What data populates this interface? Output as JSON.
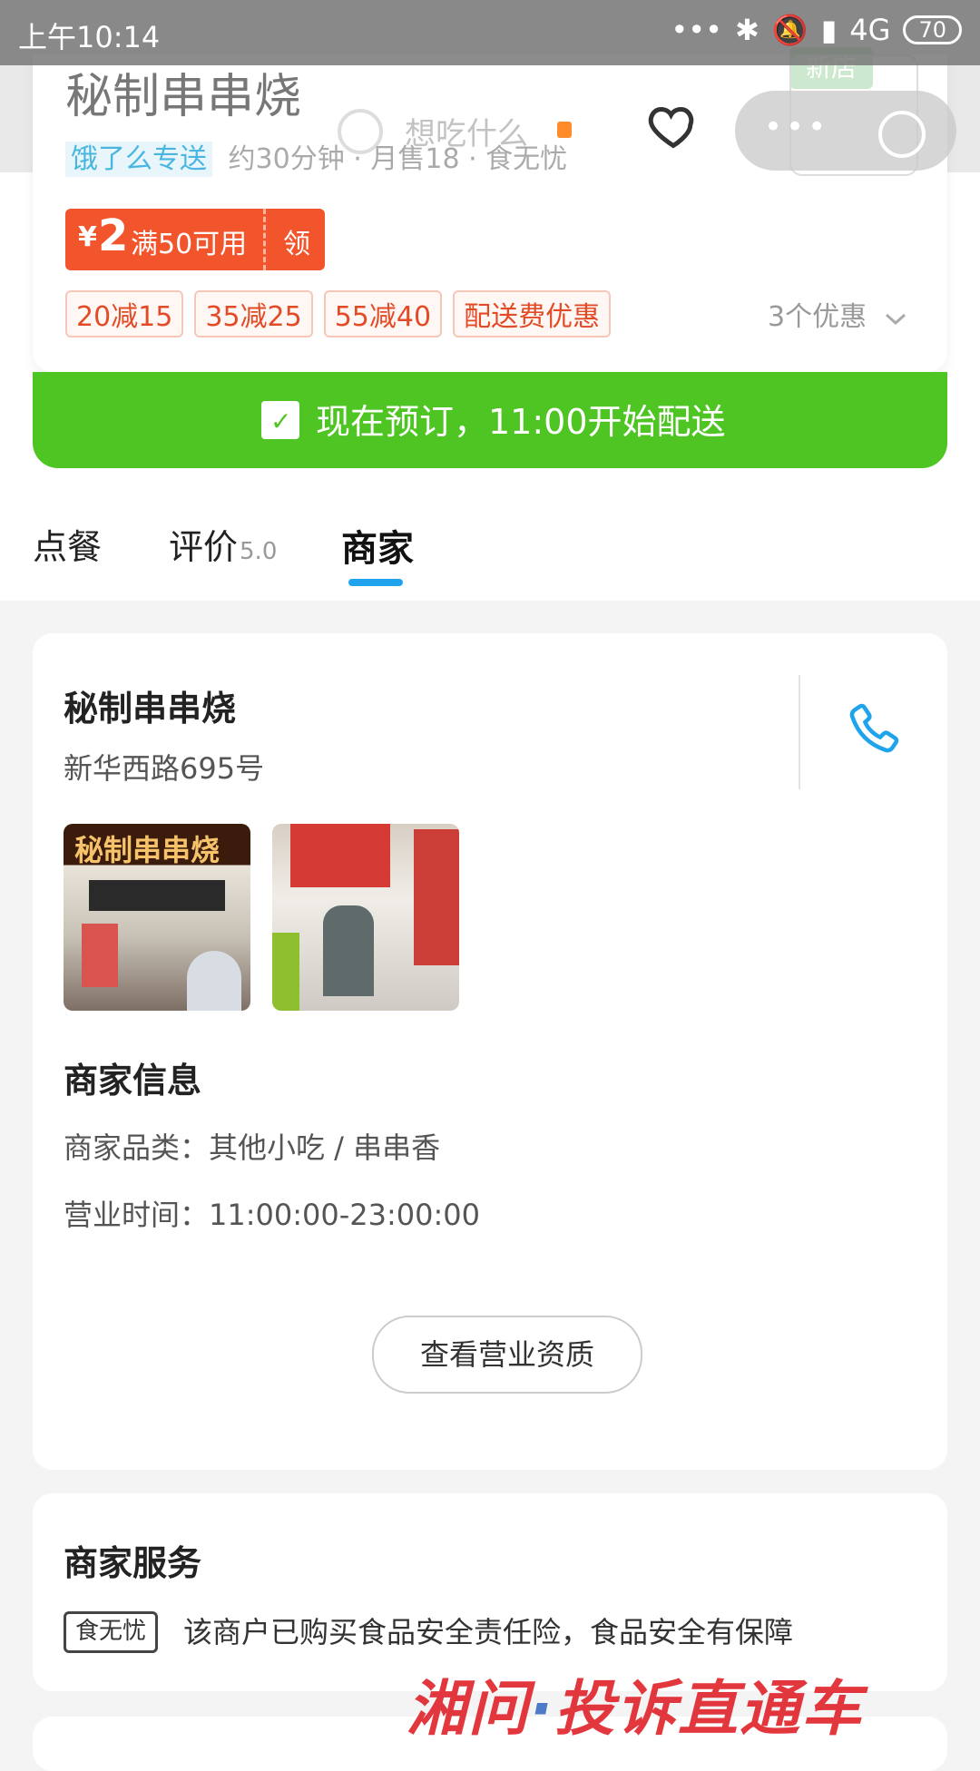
{
  "status_bar": {
    "time": "上午10:14",
    "network": "4G",
    "battery": "70"
  },
  "header": {
    "shop_name": "秘制串串烧",
    "search_placeholder": "想吃什么",
    "new_tag": "新店",
    "logo_text": "秘制串串烧",
    "brand_tag": "饿了么专送",
    "delivery_time": "约30分钟",
    "monthly_sales": "月售18",
    "safety": "食无忧"
  },
  "coupon": {
    "currency": "¥",
    "amount": "2",
    "condition": "满50可用",
    "action": "领"
  },
  "promotions": [
    "20减15",
    "35减25",
    "55减40",
    "配送费优惠"
  ],
  "promotions_more": "3个优惠",
  "preorder_banner": "现在预订，11:00开始配送",
  "tabs": {
    "order": "点餐",
    "reviews": "评价",
    "rating": "5.0",
    "merchant": "商家"
  },
  "merchant": {
    "name": "秘制串串烧",
    "address": "新华西路695号",
    "photo_sign": "秘制串串烧",
    "info_title": "商家信息",
    "category": "商家品类：其他小吃 / 串串香",
    "hours": "营业时间：11:00:00-23:00:00",
    "license_button": "查看营业资质"
  },
  "services": {
    "title": "商家服务",
    "tag": "食无忧",
    "description": "该商户已购买食品安全责任险，食品安全有保障"
  },
  "watermark": {
    "part1": "湘问",
    "dot": "·",
    "part2": "投诉直通车"
  },
  "colors": {
    "accent_blue": "#1fa3ec",
    "banner_green": "#4fc524",
    "coupon_orange": "#f2552c"
  }
}
